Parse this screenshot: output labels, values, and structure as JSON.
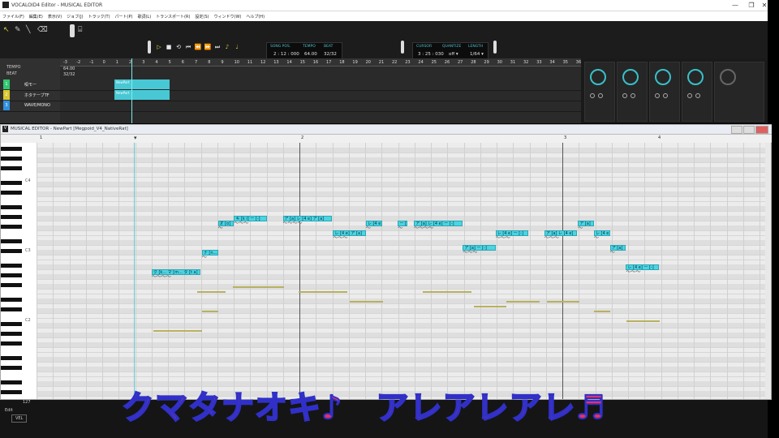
{
  "app": {
    "title": "VOCALOID4 Editor - MUSICAL EDITOR",
    "win_min": "—",
    "win_max": "❐",
    "win_close": "✕"
  },
  "menu": [
    "ファイル(F)",
    "編集(E)",
    "表示(V)",
    "ジョブ(J)",
    "トラック(T)",
    "パート(P)",
    "歌詞(L)",
    "トランスポート(R)",
    "設定(S)",
    "ウィンドウ(W)",
    "ヘルプ(H)"
  ],
  "toolbar": {
    "song_pos_label": "SONG POS.",
    "song_pos": "2 : 12 : 000",
    "tempo_label": "TEMPO",
    "tempo": "64.00",
    "beat_label": "BEAT",
    "beat": "32/32",
    "cursor_label": "CURSOR",
    "cursor": "3 : 25 : 030",
    "quantize_label": "QUANTIZE",
    "quantize": "off ▾",
    "length_label": "LENGTH",
    "length": "1/64 ▾"
  },
  "arranger": {
    "tempo_label": "TEMPO",
    "beat_label": "BEAT",
    "tempo_value": "64.00",
    "beat_value": "32/32",
    "ruler": [
      "-3",
      "-2",
      "-1",
      "0",
      "1",
      "2",
      "3",
      "4",
      "5",
      "6",
      "7",
      "8",
      "9",
      "10",
      "11",
      "12",
      "13",
      "14",
      "15",
      "16",
      "17",
      "18",
      "19",
      "20",
      "21",
      "22",
      "23",
      "24",
      "25",
      "26",
      "27",
      "28",
      "29",
      "30",
      "31",
      "32",
      "33",
      "34",
      "35",
      "36"
    ],
    "tracks": [
      {
        "num": "1",
        "name": "唄モー",
        "color": "#30c870"
      },
      {
        "num": "2",
        "name": "ホタテーブTF",
        "color": "#d8c830"
      },
      {
        "num": "3",
        "name": "WAVE/MONO",
        "color": "#3090e0"
      }
    ],
    "parts": [
      {
        "label": "NewPart"
      },
      {
        "label": "NewPart"
      }
    ]
  },
  "editor": {
    "title": "MUSICAL EDITOR - NewPart [Megpoid_V4_NativeRat]",
    "ruler": [
      "1",
      "2",
      "3",
      "4"
    ],
    "octaves": [
      "C4",
      "C3",
      "C2"
    ],
    "notes": [
      {
        "lyric": "ク [k... マ [m... タ [t a]",
        "row": 26,
        "start": 0.158,
        "len": 0.067
      },
      {
        "lyric": "ナ [n...",
        "row": 22,
        "start": 0.227,
        "len": 0.022
      },
      {
        "lyric": "オ [o]",
        "row": 16,
        "start": 0.249,
        "len": 0.022
      },
      {
        "lyric": "キ [k i]  ー [-]",
        "row": 15,
        "start": 0.271,
        "len": 0.045
      },
      {
        "lyric": "ア [a]  レ [4 e] ア [a]",
        "row": 15,
        "start": 0.338,
        "len": 0.067
      },
      {
        "lyric": "レ [4 e] ア [a]",
        "row": 18,
        "start": 0.407,
        "len": 0.045
      },
      {
        "lyric": "レ [4 e]",
        "row": 16,
        "start": 0.452,
        "len": 0.022
      },
      {
        "lyric": "ー [-]",
        "row": 16,
        "start": 0.496,
        "len": 0.013
      },
      {
        "lyric": "ア [a]  レ [4 e]  ー [-]",
        "row": 16,
        "start": 0.518,
        "len": 0.067
      },
      {
        "lyric": "ア [a]  ー [-]",
        "row": 21,
        "start": 0.585,
        "len": 0.045
      },
      {
        "lyric": "レ [4 e]  ー [-]",
        "row": 18,
        "start": 0.63,
        "len": 0.045
      },
      {
        "lyric": "ア [a]  レ [4 e]",
        "row": 18,
        "start": 0.697,
        "len": 0.045
      },
      {
        "lyric": "ア [a]",
        "row": 16,
        "start": 0.743,
        "len": 0.022
      },
      {
        "lyric": "レ [4 e]",
        "row": 18,
        "start": 0.765,
        "len": 0.022
      },
      {
        "lyric": "ア [a]",
        "row": 21,
        "start": 0.787,
        "len": 0.022
      },
      {
        "lyric": "レ [4 e]  ー [-]",
        "row": 25,
        "start": 0.809,
        "len": 0.045
      }
    ],
    "ghost_notes": [
      {
        "row": 30,
        "start": 0.22,
        "len": 0.04
      },
      {
        "row": 29,
        "start": 0.27,
        "len": 0.07
      },
      {
        "row": 34,
        "start": 0.227,
        "len": 0.022
      },
      {
        "row": 38,
        "start": 0.16,
        "len": 0.067
      },
      {
        "row": 30,
        "start": 0.36,
        "len": 0.066
      },
      {
        "row": 32,
        "start": 0.43,
        "len": 0.045
      },
      {
        "row": 30,
        "start": 0.53,
        "len": 0.067
      },
      {
        "row": 33,
        "start": 0.6,
        "len": 0.045
      },
      {
        "row": 32,
        "start": 0.645,
        "len": 0.045
      },
      {
        "row": 32,
        "start": 0.7,
        "len": 0.045
      },
      {
        "row": 34,
        "start": 0.765,
        "len": 0.022
      },
      {
        "row": 36,
        "start": 0.81,
        "len": 0.045
      }
    ],
    "vel_label": "VEL",
    "edit_label": "Edit",
    "scroll_value": "127"
  },
  "caption": "クマタナオキ♪　アレアレアレ♬"
}
